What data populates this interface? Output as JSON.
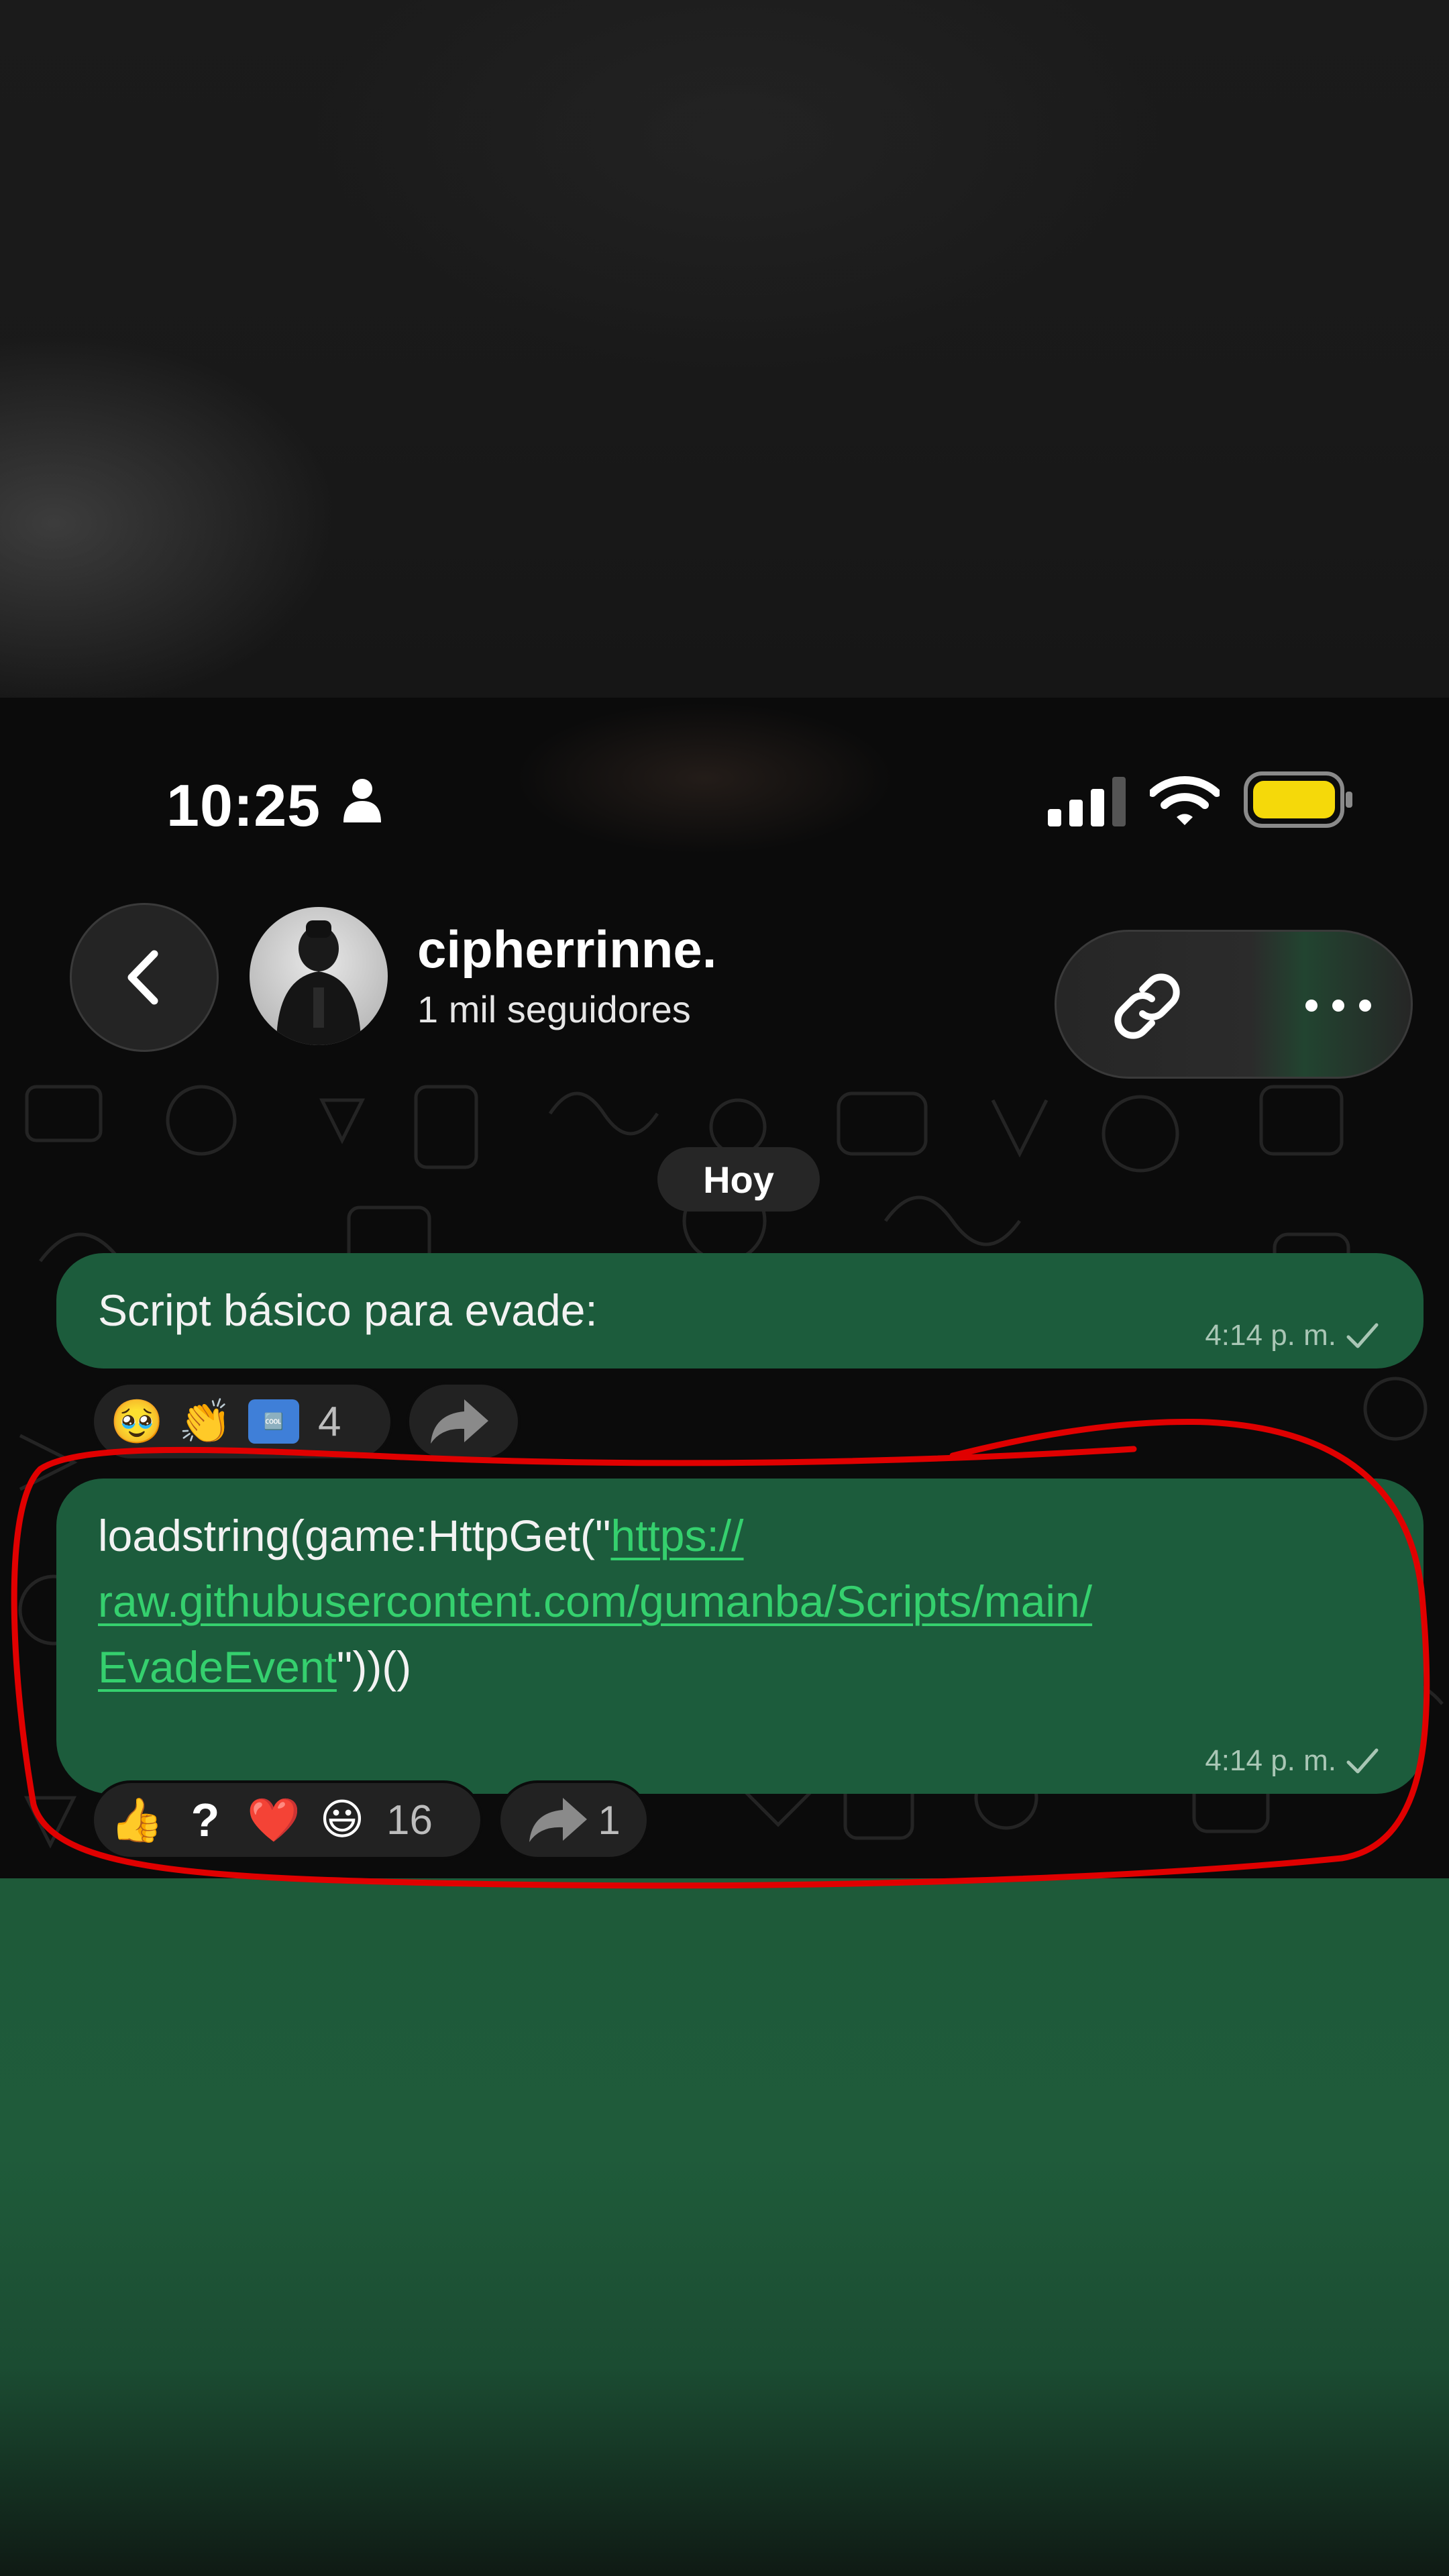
{
  "status_bar": {
    "time": "10:25",
    "icons": [
      "person-icon",
      "signal-icon",
      "wifi-icon",
      "battery-icon"
    ],
    "battery_color": "#f5d90a"
  },
  "header": {
    "back_icon": "chevron-left-icon",
    "channel_name": "cipherrinne.",
    "followers": "1 mil seguidores",
    "actions": [
      "link-icon",
      "more-icon"
    ]
  },
  "date_chip": "Hoy",
  "messages": [
    {
      "text": "Script básico para evade:",
      "time": "4:14 p. m.",
      "reactions": {
        "emojis": [
          "🥹",
          "👏",
          "🆒"
        ],
        "count": "4"
      },
      "forward_count": ""
    },
    {
      "text_prefix": "loadstring(game:HttpGet(\"",
      "link_line1": "https://",
      "link_line2": "raw.githubusercontent.com/gumanba/Scripts/main/",
      "link_line3": "EvadeEvent",
      "text_suffix": "\"))()",
      "time": "4:14 p. m.",
      "reactions": {
        "emojis": [
          "👍",
          "?",
          "❤️",
          "😃"
        ],
        "count": "16"
      },
      "forward_count": "1"
    }
  ],
  "colors": {
    "bubble": "#1c5c3c",
    "link": "#35d06e",
    "annotation": "#e00000"
  }
}
